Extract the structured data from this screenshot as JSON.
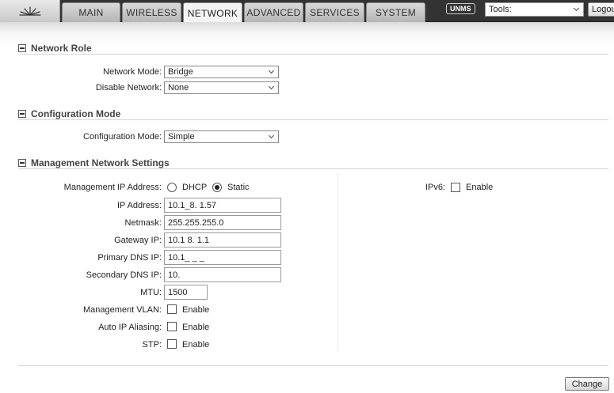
{
  "topbar": {
    "logo_icon": "ubiquiti-logo-icon",
    "tabs": [
      {
        "label": "MAIN"
      },
      {
        "label": "WIRELESS"
      },
      {
        "label": "NETWORK"
      },
      {
        "label": "ADVANCED"
      },
      {
        "label": "SERVICES"
      },
      {
        "label": "SYSTEM"
      }
    ],
    "active_tab": "NETWORK",
    "unms_badge": "UNMS",
    "tools_select": "Tools:",
    "logout_label": "Logout"
  },
  "network_role": {
    "title": "Network Role",
    "network_mode_label": "Network Mode:",
    "network_mode_value": "Bridge",
    "disable_network_label": "Disable Network:",
    "disable_network_value": "None"
  },
  "configuration_mode": {
    "title": "Configuration Mode",
    "label": "Configuration Mode:",
    "value": "Simple"
  },
  "management": {
    "title": "Management Network Settings",
    "ip_address_mode_label": "Management IP Address:",
    "dhcp_label": "DHCP",
    "static_label": "Static",
    "selected_mode": "Static",
    "ip_address_label": "IP Address:",
    "ip_address_value": "10.1_8. 1.57",
    "netmask_label": "Netmask:",
    "netmask_value": "255.255.255.0",
    "gateway_label": "Gateway IP:",
    "gateway_value": "10.1  8. 1.1",
    "primary_dns_label": "Primary DNS IP:",
    "primary_dns_value": "10.1_ _ _",
    "secondary_dns_label": "Secondary DNS IP:",
    "secondary_dns_value": "10.",
    "mtu_label": "MTU:",
    "mtu_value": "1500",
    "vlan_label": "Management VLAN:",
    "vlan_enable": "Enable",
    "auto_ip_label": "Auto IP Aliasing:",
    "auto_ip_enable": "Enable",
    "stp_label": "STP:",
    "stp_enable": "Enable",
    "ipv6_label": "IPv6:",
    "ipv6_enable": "Enable"
  },
  "footer": {
    "change_label": "Change"
  }
}
